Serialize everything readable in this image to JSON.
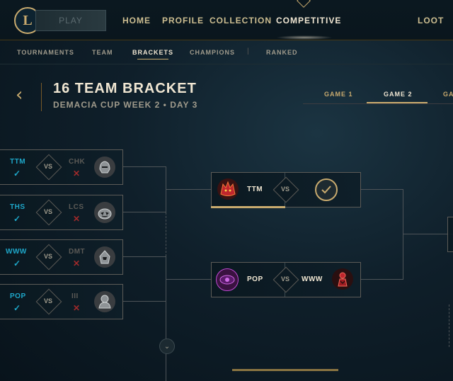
{
  "topbar": {
    "logo_letter": "L",
    "play_label": "PLAY",
    "nav": [
      "HOME",
      "PROFILE",
      "COLLECTION",
      "COMPETITIVE"
    ],
    "active_nav": "COMPETITIVE",
    "loot_label": "LOOT"
  },
  "subnav": {
    "items": [
      "TOURNAMENTS",
      "TEAM",
      "BRACKETS",
      "CHAMPIONS",
      "RANKED"
    ],
    "active": "BRACKETS",
    "separator": "|"
  },
  "header": {
    "title": "16 TEAM BRACKET",
    "subtitle": "DEMACIA CUP WEEK 2  •  DAY 3"
  },
  "game_tabs": [
    "GAME 1",
    "GAME 2",
    "GA"
  ],
  "active_game_tab": "GAME 2",
  "vs_label": "VS",
  "round1": [
    {
      "team_a": "TTM",
      "team_b": "CHK",
      "winner": "team_a",
      "emblem_b": "knight-helmet-icon"
    },
    {
      "team_a": "THS",
      "team_b": "LCS",
      "winner": "team_a",
      "emblem_b": "pumpkin-icon"
    },
    {
      "team_a": "WWW",
      "team_b": "DMT",
      "winner": "team_a",
      "emblem_b": "hooded-figure-icon"
    },
    {
      "team_a": "POP",
      "team_b": "III",
      "winner": "team_a",
      "emblem_b": "warrior-icon"
    }
  ],
  "round2": [
    {
      "team_a": "TTM",
      "team_b": "",
      "emblem_a": "red-wolf-icon",
      "emblem_b": "checkmark-icon",
      "progress": 1.0
    },
    {
      "team_a": "POP",
      "team_b": "WWW",
      "emblem_a": "purple-eye-icon",
      "emblem_b": "red-tower-icon"
    }
  ],
  "colors": {
    "gold": "#c8aa6e",
    "win_blue": "#1ea7c9",
    "loss_red": "#9e2a2b",
    "background": "#0f1f2a"
  }
}
